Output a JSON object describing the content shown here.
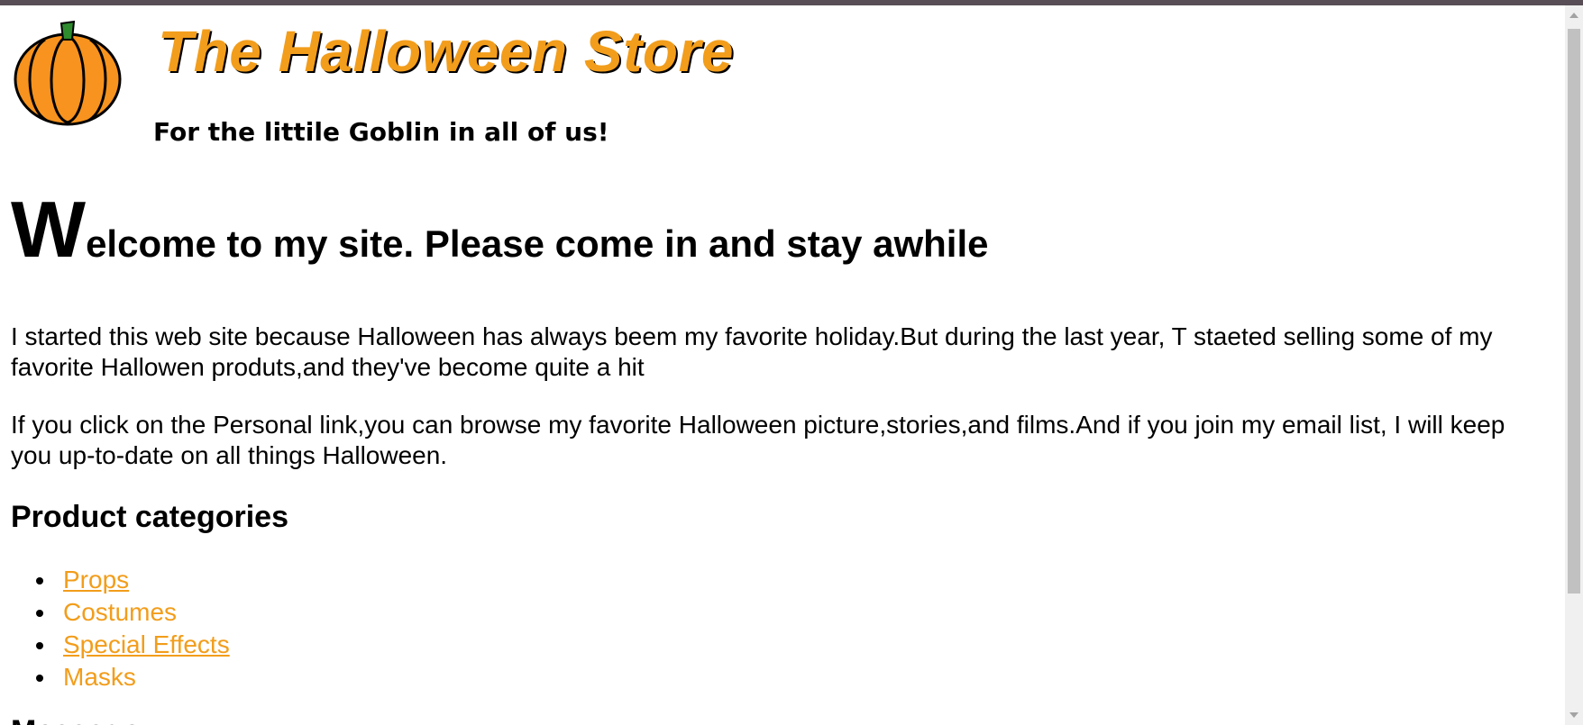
{
  "header": {
    "title": "The Halloween Store",
    "tagline": "For the littile Goblin in all of us!",
    "logo_icon": "pumpkin-icon"
  },
  "welcome": {
    "dropcap": "W",
    "rest": "elcome to my site. Please come in and stay awhile"
  },
  "paragraphs": [
    "I started this web site because Halloween has always beem my favorite holiday.But during the last year, T staeted selling some of my favorite Hallowen produts,and they've become quite a hit",
    "If you click on the Personal link,you can browse my favorite Halloween picture,stories,and films.And if you join my email list, I will keep you up-to-date on all things Halloween."
  ],
  "categories": {
    "heading": "Product categories",
    "items": [
      {
        "label": "Props",
        "is_link": true
      },
      {
        "label": "Costumes",
        "is_link": false
      },
      {
        "label": "Special Effects",
        "is_link": true
      },
      {
        "label": "Masks",
        "is_link": false
      }
    ]
  },
  "cutoff_heading": "Message",
  "colors": {
    "title_orange": "#f29d1b",
    "pumpkin_orange": "#f7931e",
    "top_border": "#574f55"
  }
}
